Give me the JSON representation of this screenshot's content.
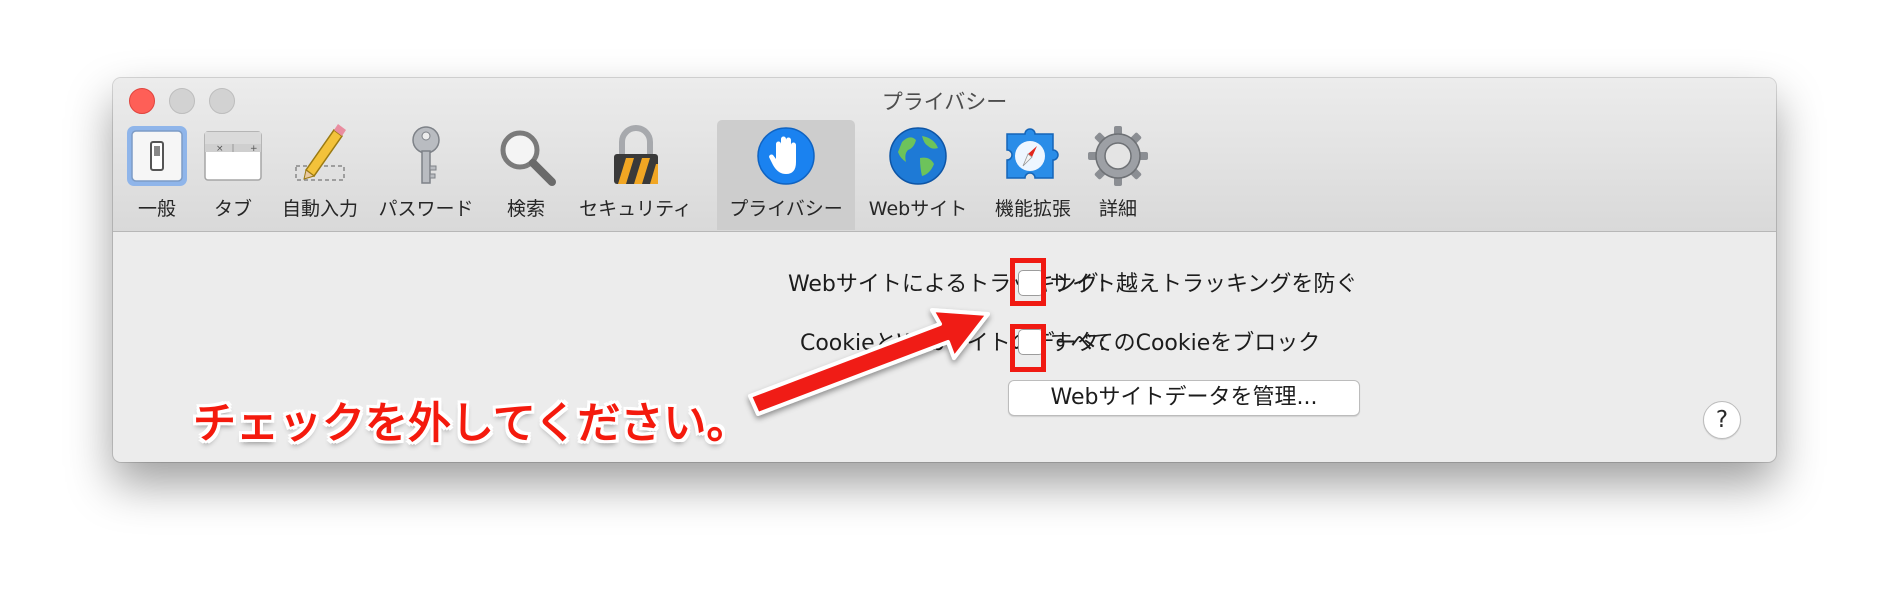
{
  "window": {
    "title": "プライバシー"
  },
  "toolbar": {
    "items": [
      {
        "label": "一般",
        "icon": "general-switch-icon",
        "selected": false
      },
      {
        "label": "タブ",
        "icon": "tabs-icon",
        "selected": false
      },
      {
        "label": "自動入力",
        "icon": "pencil-autofill-icon",
        "selected": false
      },
      {
        "label": "パスワード",
        "icon": "key-icon",
        "selected": false
      },
      {
        "label": "検索",
        "icon": "magnifier-icon",
        "selected": false
      },
      {
        "label": "セキュリティ",
        "icon": "padlock-icon",
        "selected": false
      },
      {
        "label": "プライバシー",
        "icon": "hand-icon",
        "selected": true
      },
      {
        "label": "Webサイト",
        "icon": "globe-icon",
        "selected": false
      },
      {
        "label": "機能拡張",
        "icon": "compass-puzzle-icon",
        "selected": false
      },
      {
        "label": "詳細",
        "icon": "gear-icon",
        "selected": false
      }
    ]
  },
  "privacy": {
    "tracking_label": "Webサイトによるトラッキング:",
    "tracking_option": "サイト越えトラッキングを防ぐ",
    "tracking_checked": false,
    "cookie_label": "CookieとWebサイトのデータ:",
    "cookie_option": "すべてのCookieをブロック",
    "cookie_checked": false,
    "manage_button": "Webサイトデータを管理...",
    "help_button": "?"
  },
  "annotation": {
    "callout": "チェックを外してください。",
    "color": "#f01a12"
  },
  "colors": {
    "close_button": "#fe5f57",
    "selected_tab_bg": "#cdcdcd",
    "privacy_icon_blue": "#1a82f0",
    "annotation_red": "#f01a12"
  }
}
